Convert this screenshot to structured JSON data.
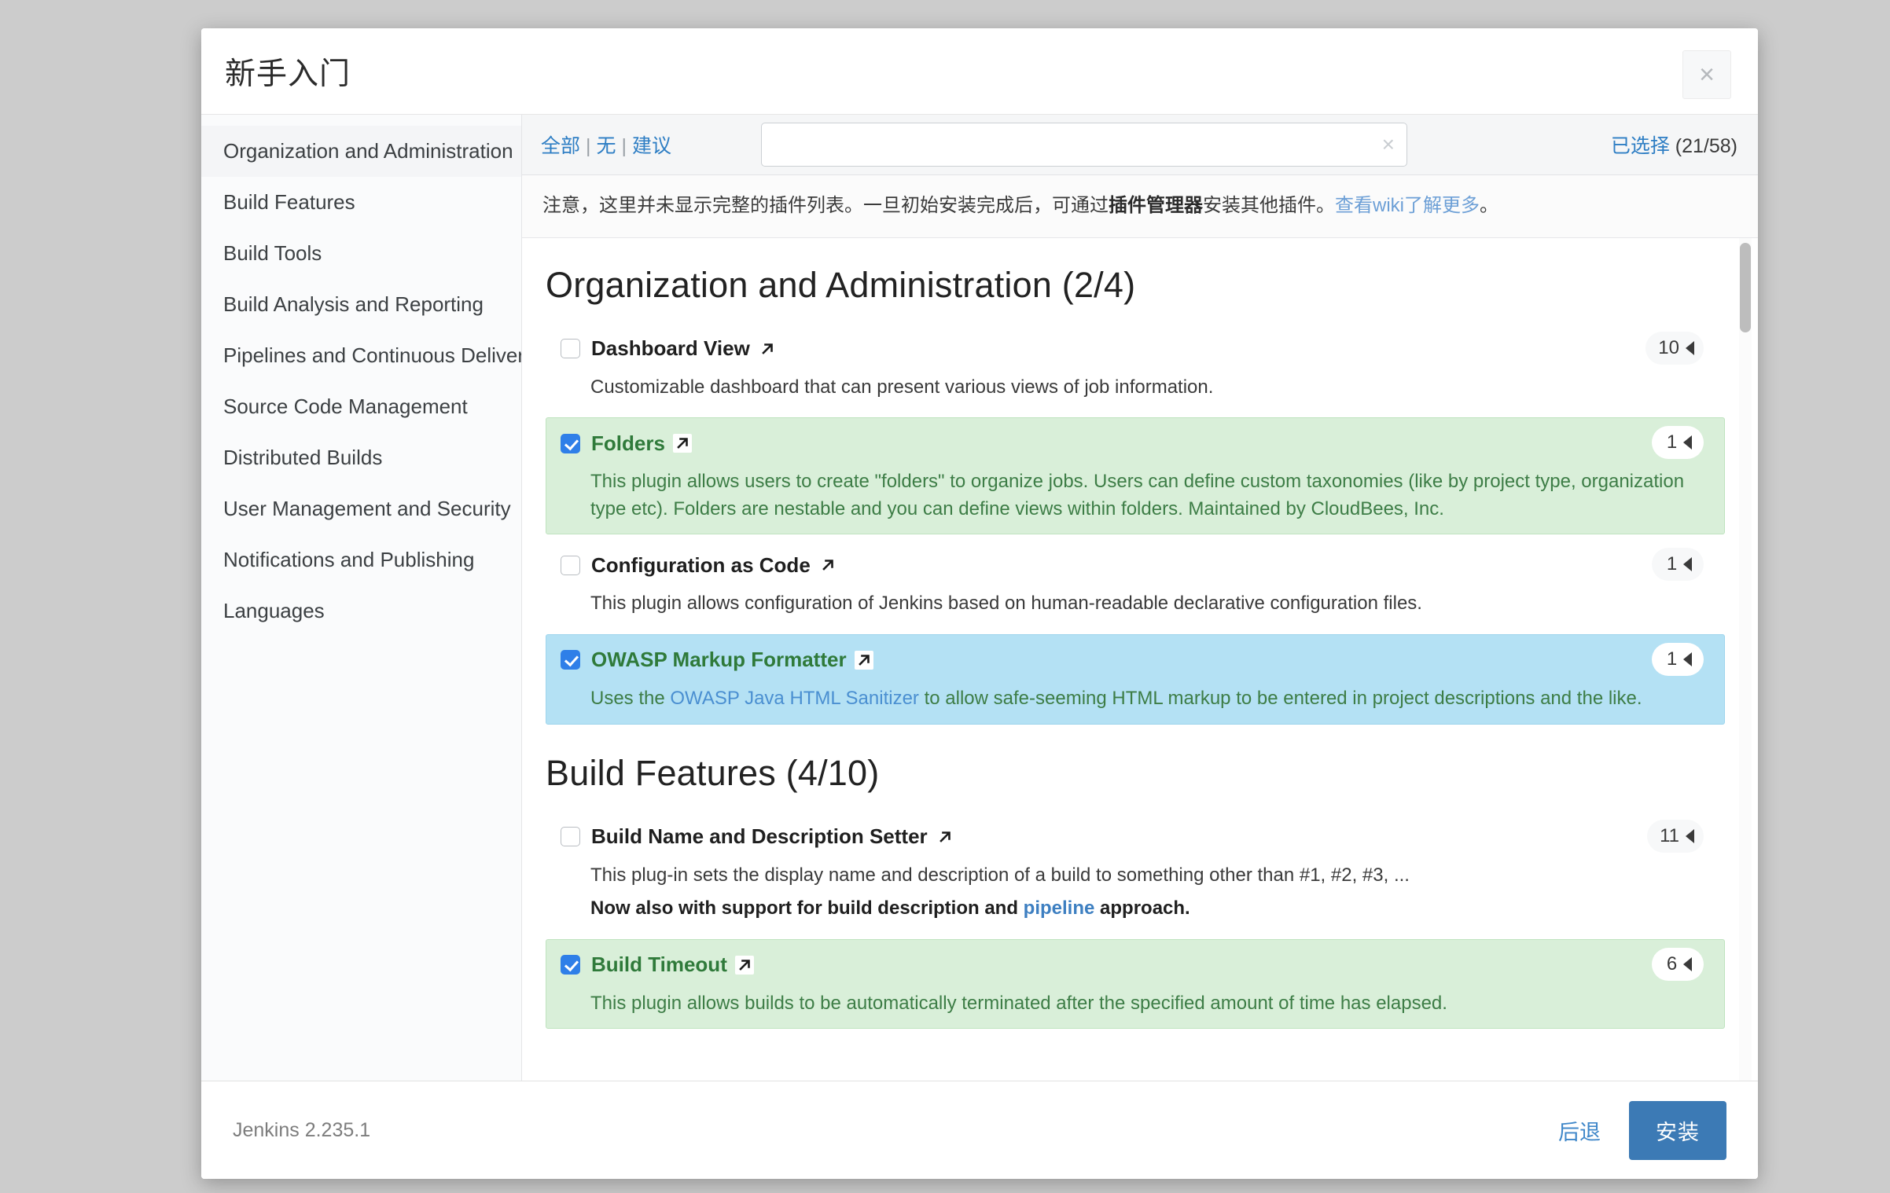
{
  "dialog": {
    "title": "新手入门",
    "close_label": "×"
  },
  "sidebar": {
    "items": [
      {
        "label": "Organization and Administration",
        "active": true
      },
      {
        "label": "Build Features",
        "active": false
      },
      {
        "label": "Build Tools",
        "active": false
      },
      {
        "label": "Build Analysis and Reporting",
        "active": false
      },
      {
        "label": "Pipelines and Continuous Delivery",
        "active": false
      },
      {
        "label": "Source Code Management",
        "active": false
      },
      {
        "label": "Distributed Builds",
        "active": false
      },
      {
        "label": "User Management and Security",
        "active": false
      },
      {
        "label": "Notifications and Publishing",
        "active": false
      },
      {
        "label": "Languages",
        "active": false
      }
    ]
  },
  "toolbar": {
    "filter_all": "全部",
    "filter_none": "无",
    "filter_suggested": "建议",
    "separator": "|",
    "search_value": "",
    "search_placeholder": "",
    "clear_icon": "×",
    "selected_label": "已选择",
    "selected_count": "(21/58)"
  },
  "notice": {
    "part1": "注意，这里并未显示完整的插件列表。一旦初始安装完成后，可通过",
    "bold": "插件管理器",
    "part2": "安装其他插件。",
    "link": "查看wiki了解更多",
    "part3": "。"
  },
  "sections": [
    {
      "heading": "Organization and Administration (2/4)",
      "plugins": [
        {
          "name": "Dashboard View",
          "checked": false,
          "highlight": "none",
          "badge": "10",
          "description": "Customizable dashboard that can present various views of job information."
        },
        {
          "name": "Folders",
          "checked": true,
          "highlight": "green",
          "badge": "1",
          "description": "This plugin allows users to create \"folders\" to organize jobs. Users can define custom taxonomies (like by project type, organization type etc). Folders are nestable and you can define views within folders. Maintained by CloudBees, Inc."
        },
        {
          "name": "Configuration as Code",
          "checked": false,
          "highlight": "none",
          "badge": "1",
          "description": "This plugin allows configuration of Jenkins based on human-readable declarative configuration files."
        },
        {
          "name": "OWASP Markup Formatter",
          "checked": true,
          "highlight": "blue",
          "badge": "1",
          "desc_prefix": "Uses the ",
          "desc_link": "OWASP Java HTML Sanitizer",
          "desc_suffix": " to allow safe-seeming HTML markup to be entered in project descriptions and the like."
        }
      ]
    },
    {
      "heading": "Build Features (4/10)",
      "plugins": [
        {
          "name": "Build Name and Description Setter",
          "checked": false,
          "highlight": "none",
          "badge": "11",
          "description": "This plug-in sets the display name and description of a build to something other than #1, #2, #3, ...",
          "bold_prefix": "Now also with support for build description and ",
          "bold_link": "pipeline",
          "bold_suffix": " approach."
        },
        {
          "name": "Build Timeout",
          "checked": true,
          "highlight": "green",
          "badge": "6",
          "description": "This plugin allows builds to be automatically terminated after the specified amount of time has elapsed."
        }
      ]
    }
  ],
  "footer": {
    "version": "Jenkins 2.235.1",
    "back_label": "后退",
    "install_label": "安装"
  }
}
